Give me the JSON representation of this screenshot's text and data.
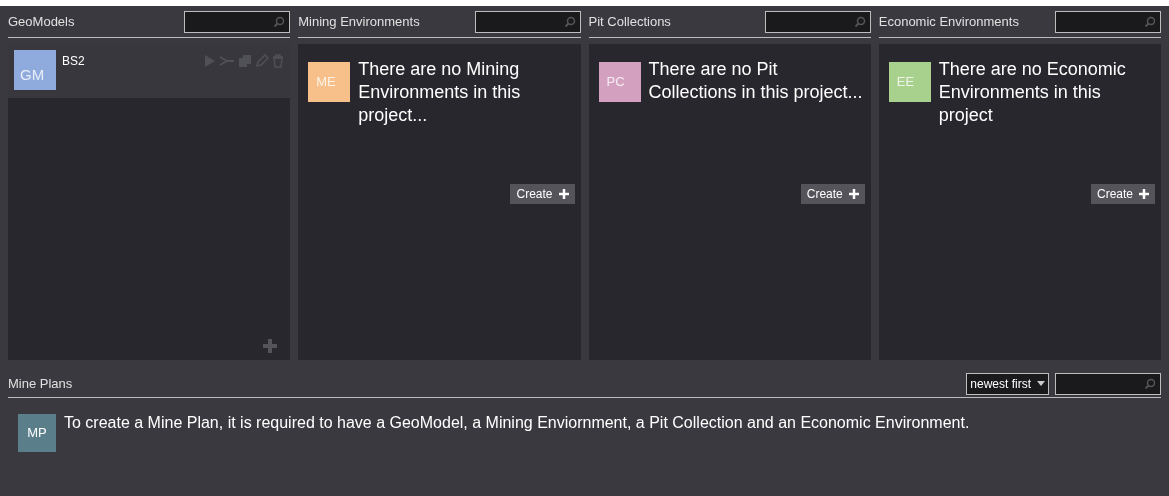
{
  "columns": [
    {
      "kind": "list",
      "title": "GeoModels",
      "items": [
        {
          "avatar": "GM",
          "color": "#8faadc",
          "name": "BS2",
          "selected": true
        }
      ]
    },
    {
      "kind": "empty",
      "title": "Mining Environments",
      "avatar": "ME",
      "color": "#f7c08a",
      "message": "There are no Mining Environments in this project...",
      "create": "Create"
    },
    {
      "kind": "empty",
      "title": "Pit Collections",
      "avatar": "PC",
      "color": "#d4a0c0",
      "message": "There are no Pit Collections in this project...",
      "create": "Create"
    },
    {
      "kind": "empty",
      "title": "Economic Environments",
      "avatar": "EE",
      "color": "#a9d18e",
      "message": "There are no Economic Environments in this project",
      "create": "Create"
    }
  ],
  "mine_plans": {
    "title": "Mine Plans",
    "sort": "newest first",
    "avatar": "MP",
    "color": "#5b7f8a",
    "message": "To create a Mine Plan, it is required to have a GeoModel, a Mining Enviornment, a Pit Collection and an Economic Environment."
  }
}
